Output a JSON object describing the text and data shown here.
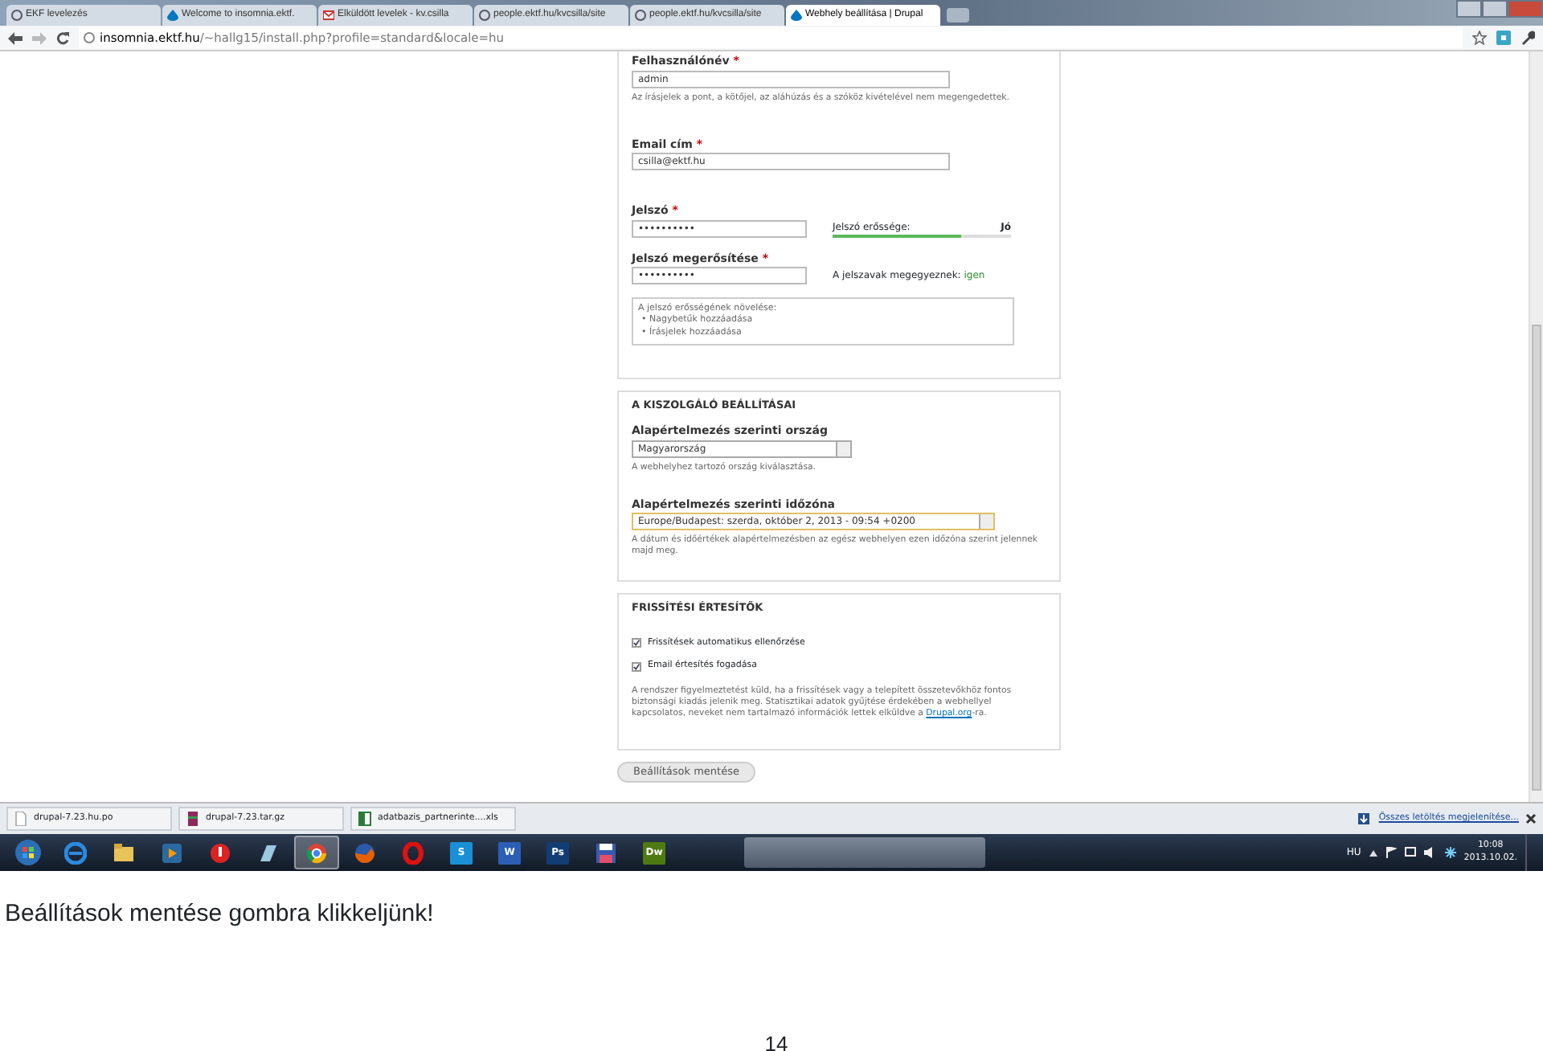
{
  "browser": {
    "tabs": [
      {
        "label": "EKF levelezés",
        "selected": false,
        "kind": "globe"
      },
      {
        "label": "Welcome to insomnia.ektf.",
        "selected": false,
        "kind": "drupal"
      },
      {
        "label": "Elküldött levelek - kv.csilla",
        "selected": false,
        "kind": "mail"
      },
      {
        "label": "people.ektf.hu/kvcsilla/site",
        "selected": false,
        "kind": "globe"
      },
      {
        "label": "people.ektf.hu/kvcsilla/site",
        "selected": false,
        "kind": "globe"
      },
      {
        "label": "Webhely beállítása | Drupal",
        "selected": true,
        "kind": "drupal"
      }
    ],
    "url": {
      "host": "insomnia.ektf.hu",
      "path": "/~hallg15/install.php?profile=standard&locale=hu"
    }
  },
  "account": {
    "username": {
      "label": "Felhasználónév",
      "required_mark": "*",
      "value": "admin",
      "description": "Az írásjelek a pont, a kötőjel, az aláhúzás és a szóköz kivételével nem megengedettek."
    },
    "email": {
      "label": "Email cím",
      "required_mark": "*",
      "value": "csilla@ektf.hu"
    },
    "password": {
      "label": "Jelszó",
      "required_mark": "*",
      "value": "••••••••••",
      "strength_label": "Jelszó erőssége:",
      "strength_value": "Jó",
      "level": 0.72
    },
    "confirm": {
      "label": "Jelszó megerősítése",
      "required_mark": "*",
      "value": "••••••••••",
      "match_label": "A jelszavak megegyeznek:",
      "match_value": "igen"
    },
    "tips": {
      "title": "A jelszó erősségének növelése:",
      "bullet": "•",
      "items": [
        "Nagybetűk hozzáadása",
        "Írásjelek hozzáadása"
      ]
    }
  },
  "server": {
    "title": "A KISZOLGÁLÓ BEÁLLÍTÁSAI",
    "country": {
      "label": "Alapértelmezés szerinti ország",
      "value": "Magyarország",
      "focused": false,
      "description": "A webhelyhez tartozó ország kiválasztása."
    },
    "timezone": {
      "label": "Alapértelmezés szerinti időzóna",
      "value": "Europe/Budapest: szerda, október 2, 2013 - 09:54 +0200",
      "focused": true,
      "description": "A dátum és időértékek alapértelmezésben az egész webhelyen ezen időzóna szerint jelennek majd meg."
    }
  },
  "updates": {
    "title": "FRISSÍTÉSI ÉRTESÍTŐK",
    "checkboxes": [
      {
        "label": "Frissítések automatikus ellenőrzése",
        "checked": true
      },
      {
        "label": "Email értesítés fogadása",
        "checked": true
      }
    ],
    "description_before": "A rendszer figyelmeztetést küld, ha a frissítések vagy a telepített összetevőkhöz fontos biztonsági kiadás jelenik meg. Statisztikai adatok gyűjtése érdekében a webhellyel kapcsolatos, neveket nem tartalmazó információk lettek elküldve a ",
    "description_link": "Drupal.org",
    "description_after": "-ra."
  },
  "submit": "Beállítások mentése",
  "downloads": {
    "items": [
      {
        "name": "drupal-7.23.hu.po",
        "kind": "file"
      },
      {
        "name": "drupal-7.23.tar.gz",
        "kind": "archive"
      },
      {
        "name": "adatbazis_partnerinte....xls",
        "kind": "sheet"
      }
    ],
    "show_all": "Összes letöltés megjelenítése..."
  },
  "taskbar": {
    "apps": [
      {
        "kind": "ie",
        "selected": false
      },
      {
        "kind": "folder",
        "selected": false
      },
      {
        "kind": "media",
        "selected": false
      },
      {
        "kind": "red",
        "selected": false
      },
      {
        "kind": "glass",
        "selected": false
      },
      {
        "kind": "chrome",
        "selected": true
      },
      {
        "kind": "firefox",
        "selected": false
      },
      {
        "kind": "opera",
        "selected": false
      },
      {
        "kind": "letter",
        "label": "S",
        "color": "#1a8fd6",
        "selected": false
      },
      {
        "kind": "letter",
        "label": "W",
        "color": "#2b5fb5",
        "selected": false
      },
      {
        "kind": "letter",
        "label": "Ps",
        "color": "#123c74",
        "selected": false
      },
      {
        "kind": "floppy",
        "selected": false
      },
      {
        "kind": "letter",
        "label": "Dw",
        "color": "#4f7a12",
        "selected": false
      }
    ],
    "tray": {
      "language": "HU",
      "time": "10:08",
      "date": "2013.10.02."
    }
  },
  "caption": "Beállítások mentése gombra klikkeljünk!",
  "page_number": "14"
}
